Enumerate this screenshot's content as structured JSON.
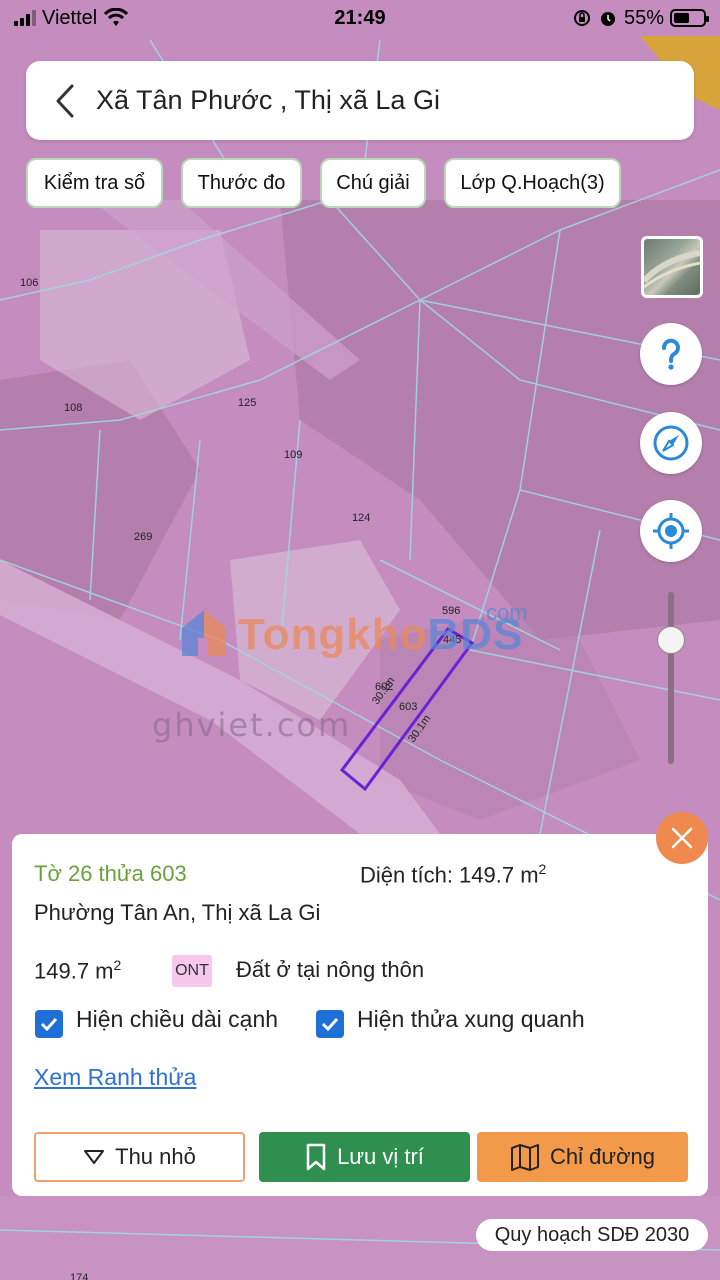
{
  "status_bar": {
    "carrier": "Viettel",
    "time": "21:49",
    "battery": "55%",
    "battery_level": 0.55
  },
  "search": {
    "title": "Xã Tân Phước , Thị xã La Gi"
  },
  "chips": [
    "Kiểm tra sổ",
    "Thước đo",
    "Chú giải",
    "Lớp Q.Hoạch(3)"
  ],
  "controls": {
    "help_icon": "help-icon",
    "compass_icon": "compass-icon",
    "locate_icon": "locate-icon",
    "zoom_level": 0.28
  },
  "map": {
    "parcel_numbers": [
      "106",
      "108",
      "125",
      "109",
      "269",
      "124",
      "596",
      "445",
      "602",
      "603"
    ],
    "parcel_labels": [
      "106",
      "108",
      "125",
      "109",
      "269",
      "124",
      "596",
      "445",
      "602",
      "603",
      "174"
    ],
    "edge_a": "30.1m",
    "edge_b": "30.1m",
    "watermark_a": "Tongkho",
    "watermark_b": "BDS",
    "watermark_com": ".com",
    "faint_text": "ghviet.com",
    "overlay_color": "#c98cc2",
    "parcel_outline_color": "#6a22d6"
  },
  "panel": {
    "parcel_id": "Tờ 26 thửa 603",
    "area_label": "Diện tích: 149.7 m",
    "area_sup": "2",
    "address": "Phường Tân An, Thị xã La Gi",
    "area_value": "149.7 m",
    "area_value_sup": "2",
    "land_code": "ONT",
    "land_type": "Đất ở tại nông thôn",
    "show_edge_length": "Hiện chiều dài cạnh",
    "show_neighbors": "Hiện thửa xung quanh",
    "view_boundary": "Xem Ranh thửa",
    "collapse_button": "Thu nhỏ",
    "save_button": "Lưu vị trí",
    "directions_button": "Chỉ đường"
  },
  "plan_label": "Quy hoạch SDĐ 2030",
  "colors": {
    "accent_green": "#2f8f4e",
    "accent_orange": "#f39a4a",
    "link_blue": "#2f6fd6",
    "checkbox_blue": "#1e6fd6"
  }
}
